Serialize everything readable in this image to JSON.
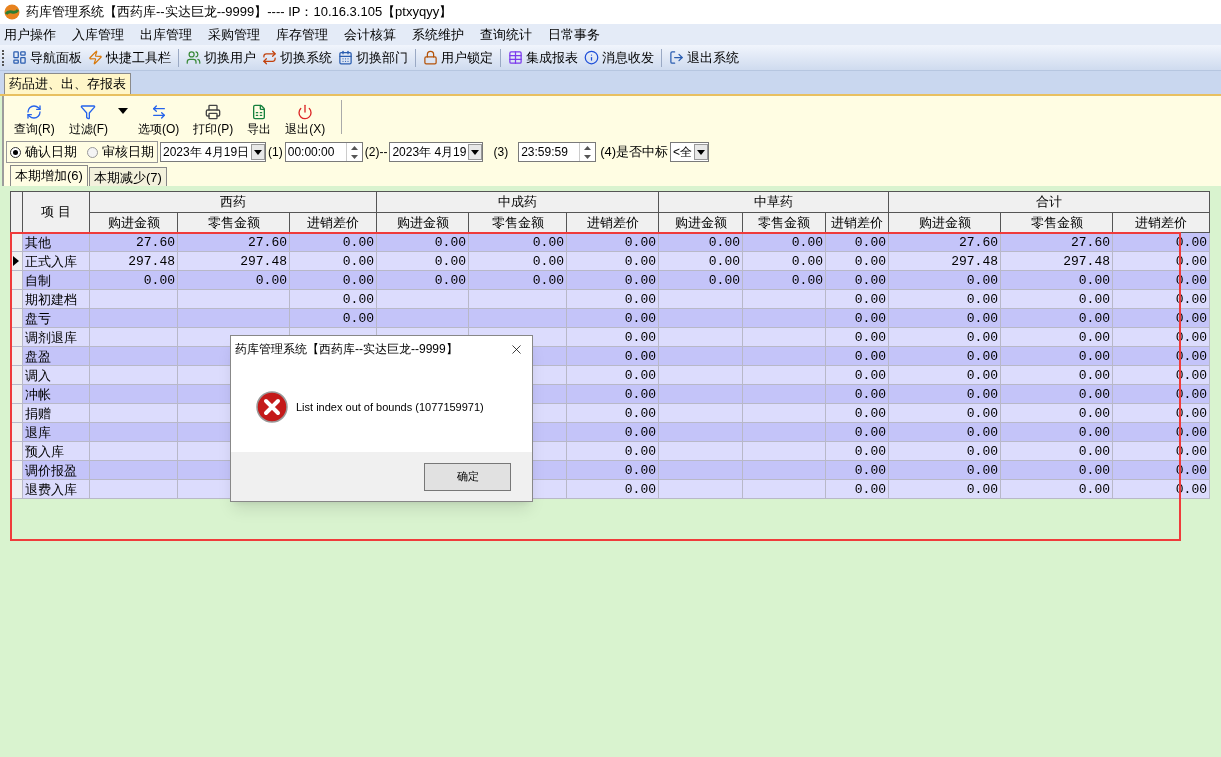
{
  "window": {
    "title": "药库管理系统【西药库--实达巨龙--9999】---- IP：10.16.3.105【ptxyqyy】"
  },
  "menu": [
    "用户操作",
    "入库管理",
    "出库管理",
    "采购管理",
    "库存管理",
    "会计核算",
    "系统维护",
    "查询统计",
    "日常事务"
  ],
  "toolbar_groups": [
    [
      "导航面板",
      "快捷工具栏"
    ],
    [
      "切换用户",
      "切换系统",
      "切换部门"
    ],
    [
      "用户锁定"
    ],
    [
      "集成报表",
      "消息收发"
    ],
    [
      "退出系统"
    ]
  ],
  "doc_tabs": [
    {
      "label": "药品进、出、存报表",
      "selected": true
    }
  ],
  "report_toolbar": [
    "查询(R)",
    "过滤(F)",
    "选项(O)",
    "打印(P)",
    "导出",
    "退出(X)"
  ],
  "date_modes": [
    {
      "label": "确认日期",
      "selected": true
    },
    {
      "label": "审核日期",
      "selected": false
    }
  ],
  "filters": {
    "date_from": "2023年 4月19日",
    "label_1": "(1)",
    "time_from": "00:00:00",
    "label_2": "(2)--",
    "date_to": "2023年 4月19",
    "label_3": "(3)",
    "time_to": "23:59:59",
    "label_4": "(4)是否中标",
    "bid_combo": "<全"
  },
  "sub_tabs": [
    {
      "label": "本期增加(6)",
      "selected": true
    },
    {
      "label": "本期减少(7)",
      "selected": false
    }
  ],
  "table": {
    "item_header": "项 目",
    "groups": [
      {
        "label": "西药",
        "columns": [
          "购进金额",
          "零售金额",
          "进销差价"
        ]
      },
      {
        "label": "中成药",
        "columns": [
          "购进金额",
          "零售金额",
          "进销差价"
        ]
      },
      {
        "label": "中草药",
        "columns": [
          "购进金额",
          "零售金额",
          "进销差价"
        ]
      },
      {
        "label": "合计",
        "columns": [
          "购进金额",
          "零售金额",
          "进销差价"
        ]
      }
    ],
    "rows": [
      {
        "item": "其他",
        "selected": false,
        "cells": [
          "27.60",
          "27.60",
          "0.00",
          "0.00",
          "0.00",
          "0.00",
          "0.00",
          "0.00",
          "0.00",
          "27.60",
          "27.60",
          "0.00"
        ]
      },
      {
        "item": "正式入库",
        "selected": true,
        "cells": [
          "297.48",
          "297.48",
          "0.00",
          "0.00",
          "0.00",
          "0.00",
          "0.00",
          "0.00",
          "0.00",
          "297.48",
          "297.48",
          "0.00"
        ]
      },
      {
        "item": "自制",
        "selected": false,
        "cells": [
          "0.00",
          "0.00",
          "0.00",
          "0.00",
          "0.00",
          "0.00",
          "0.00",
          "0.00",
          "0.00",
          "0.00",
          "0.00",
          "0.00"
        ]
      },
      {
        "item": "期初建档",
        "selected": false,
        "cells": [
          null,
          null,
          "0.00",
          null,
          null,
          "0.00",
          null,
          null,
          "0.00",
          "0.00",
          "0.00",
          "0.00"
        ]
      },
      {
        "item": "盘亏",
        "selected": false,
        "cells": [
          null,
          null,
          "0.00",
          null,
          null,
          "0.00",
          null,
          null,
          "0.00",
          "0.00",
          "0.00",
          "0.00"
        ]
      },
      {
        "item": "调剂退库",
        "selected": false,
        "cells": [
          null,
          null,
          null,
          null,
          null,
          "0.00",
          null,
          null,
          "0.00",
          "0.00",
          "0.00",
          "0.00"
        ]
      },
      {
        "item": "盘盈",
        "selected": false,
        "cells": [
          null,
          null,
          null,
          null,
          null,
          "0.00",
          null,
          null,
          "0.00",
          "0.00",
          "0.00",
          "0.00"
        ]
      },
      {
        "item": "调入",
        "selected": false,
        "cells": [
          null,
          null,
          null,
          null,
          null,
          "0.00",
          null,
          null,
          "0.00",
          "0.00",
          "0.00",
          "0.00"
        ]
      },
      {
        "item": "冲帐",
        "selected": false,
        "cells": [
          null,
          null,
          null,
          null,
          null,
          "0.00",
          null,
          null,
          "0.00",
          "0.00",
          "0.00",
          "0.00"
        ]
      },
      {
        "item": "捐赠",
        "selected": false,
        "cells": [
          null,
          null,
          null,
          null,
          null,
          "0.00",
          null,
          null,
          "0.00",
          "0.00",
          "0.00",
          "0.00"
        ]
      },
      {
        "item": "退库",
        "selected": false,
        "cells": [
          null,
          null,
          null,
          null,
          null,
          "0.00",
          null,
          null,
          "0.00",
          "0.00",
          "0.00",
          "0.00"
        ]
      },
      {
        "item": "预入库",
        "selected": false,
        "cells": [
          null,
          null,
          null,
          null,
          null,
          "0.00",
          null,
          null,
          "0.00",
          "0.00",
          "0.00",
          "0.00"
        ]
      },
      {
        "item": "调价报盈",
        "selected": false,
        "cells": [
          null,
          null,
          null,
          null,
          null,
          "0.00",
          null,
          null,
          "0.00",
          "0.00",
          "0.00",
          "0.00"
        ]
      },
      {
        "item": "退费入库",
        "selected": false,
        "cells": [
          null,
          null,
          null,
          null,
          null,
          "0.00",
          null,
          null,
          "0.00",
          "0.00",
          "0.00",
          "0.00"
        ]
      }
    ]
  },
  "dialog": {
    "title": "药库管理系统【西药库--实达巨龙--9999】",
    "message": "List index out of bounds (1077159971)",
    "button": "确定"
  }
}
